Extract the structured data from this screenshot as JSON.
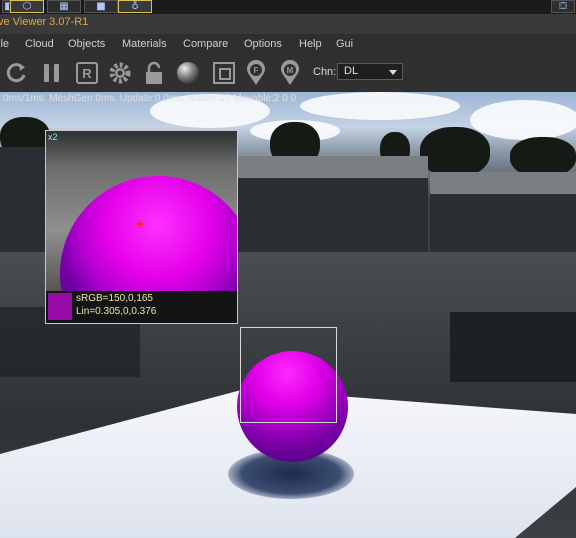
{
  "app": {
    "title": "ve Viewer 3.07-R1"
  },
  "menu": [
    "ile",
    "Cloud",
    "Objects",
    "Materials",
    "Compare",
    "Options",
    "Help",
    "Gui"
  ],
  "toolbar": {
    "channel_label": "Chn:",
    "channel_value": "DL",
    "icons": [
      "refresh-icon",
      "pause-icon",
      "region-icon",
      "gear-icon",
      "lock-icon",
      "material-sphere-icon",
      "crop-icon",
      "focus-pin-icon",
      "material-pin-icon"
    ]
  },
  "viewport": {
    "stats": "):0ms/1ms. MeshGen:0ms. Update:0.0ms. Nodes:16 Movable:2  0  0"
  },
  "zoom": {
    "label": "x2",
    "srgb": "sRGB=150,0,165",
    "lin": "Lin=0.305,0,0.376",
    "swatch_color": "#960aa5"
  },
  "colors": {
    "title": "#e8a640",
    "accent": "#d8c25a",
    "sphere": "#c000d8"
  }
}
